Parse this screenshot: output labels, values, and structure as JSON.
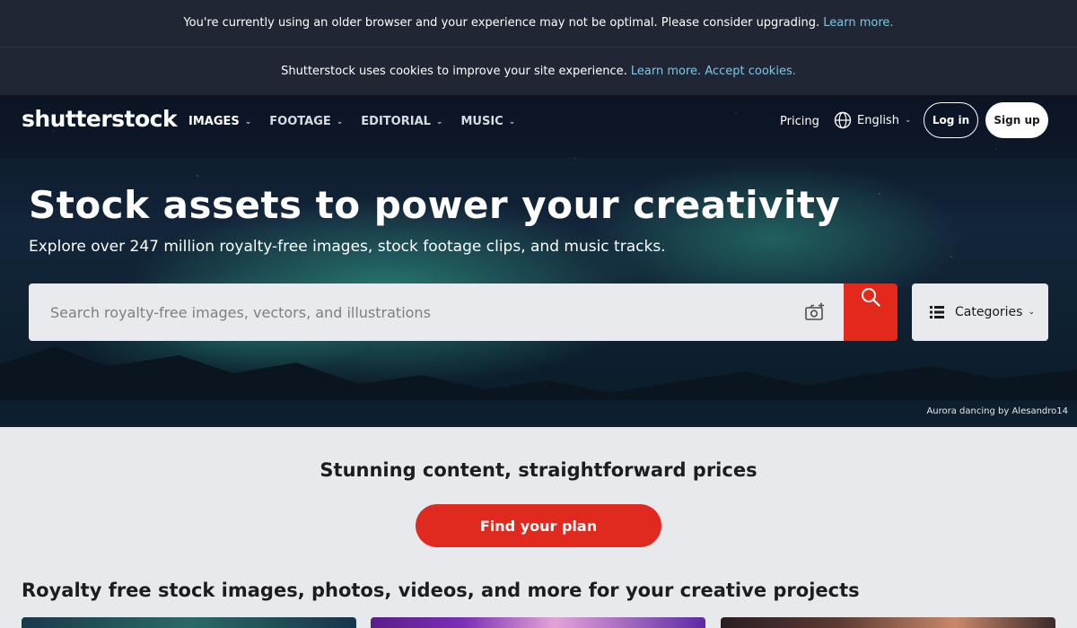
{
  "banners": {
    "browser_text": "You're currently using an older browser and your experience may not be optimal. Please consider upgrading.",
    "browser_link": "Learn more.",
    "cookie_text": "Shutterstock uses cookies to improve your site experience.",
    "cookie_learn_link": "Learn more.",
    "cookie_accept_link": "Accept cookies."
  },
  "header": {
    "logo": "shutterstock",
    "nav": [
      {
        "label": "IMAGES"
      },
      {
        "label": "FOOTAGE"
      },
      {
        "label": "EDITORIAL"
      },
      {
        "label": "MUSIC"
      }
    ],
    "pricing": "Pricing",
    "language": "English",
    "login": "Log in",
    "signup": "Sign up"
  },
  "hero": {
    "title": "Stock assets to power your creativity",
    "subtitle": "Explore over 247 million royalty-free images, stock footage clips, and music tracks.",
    "search_placeholder": "Search royalty-free images, vectors, and illustrations",
    "categories_label": "Categories",
    "credit": "Aurora dancing by Alesandro14"
  },
  "pricing_section": {
    "title": "Stunning content, straightforward prices",
    "button": "Find your plan"
  },
  "collection": {
    "title": "Royalty free stock images, photos, videos, and more for your creative projects"
  },
  "colors": {
    "brand_red": "#e2291c",
    "banner_bg": "#202634",
    "link": "#7ec8e3"
  }
}
